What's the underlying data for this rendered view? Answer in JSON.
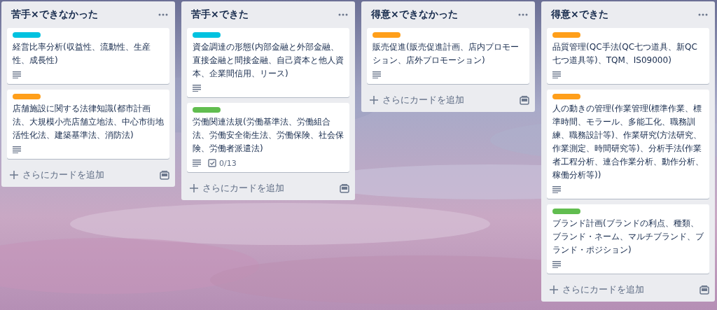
{
  "lists": [
    {
      "title": "苦手×できなかった",
      "add_card": "さらにカードを追加",
      "cards": [
        {
          "color": "#00c2e0",
          "title": "経営比率分析(収益性、流動性、生産性、成長性)",
          "description": true
        },
        {
          "color": "#ff9f1a",
          "title": "店舗施設に関する法律知識(都市計画法、大規模小売店舗立地法、中心市街地活性化法、建築基準法、消防法)",
          "description": true
        }
      ]
    },
    {
      "title": "苦手×できた",
      "add_card": "さらにカードを追加",
      "cards": [
        {
          "color": "#00c2e0",
          "title": "資金調達の形態(内部金融と外部金融、直接金融と間接金融、自己資本と他人資本、企業間信用、リース)",
          "description": true
        },
        {
          "color": "#61bd4f",
          "title": "労働関連法規(労働基準法、労働組合法、労働安全衛生法、労働保険、社会保険、労働者派遣法)",
          "description": true,
          "checklist": "0/13"
        }
      ]
    },
    {
      "title": "得意×できなかった",
      "add_card": "さらにカードを追加",
      "cards": [
        {
          "color": "#ff9f1a",
          "title": "販売促進(販売促進計画、店内プロモーション、店外プロモーション)",
          "description": true
        }
      ]
    },
    {
      "title": "得意×できた",
      "add_card": "さらにカードを追加",
      "cards": [
        {
          "color": "#ff9f1a",
          "title": "品質管理(QC手法(QC七つ道具、新QC七つ道具等)、TQM、IS09000)",
          "description": true
        },
        {
          "color": "#ff9f1a",
          "title": "人の動きの管理(作業管理(標準作業、標準時間、モラール、多能工化、職務訓練、職務設計等)、作業研究(方法研究、作業測定、時間研究等)、分析手法(作業者工程分析、連合作業分析、動作分析、稼働分析等))",
          "description": true
        },
        {
          "color": "#61bd4f",
          "title": "ブランド計画(ブランドの利点、種類、ブランド・ネーム、マルチブランド、ブランド・ポジション)",
          "description": true
        }
      ]
    }
  ]
}
